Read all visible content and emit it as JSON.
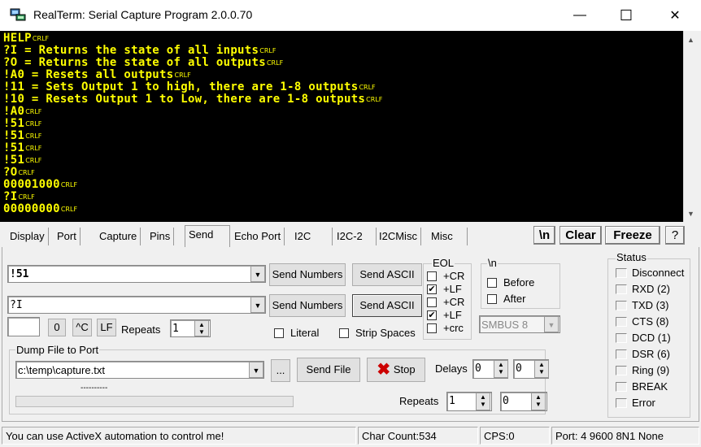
{
  "window": {
    "title": "RealTerm: Serial Capture Program 2.0.0.70",
    "minimize": "—",
    "maximize": "☐",
    "close": "✕"
  },
  "terminal": {
    "eol_marker": "CRLF",
    "lines": [
      "HELP",
      "?I = Returns the state of all inputs",
      "?O = Returns the state of all outputs",
      "!A0 = Resets all outputs",
      "!11 = Sets Output 1 to high, there are 1-8 outputs",
      "!10 = Resets Output 1 to Low, there are 1-8 outputs",
      "!A0",
      "!51",
      "!51",
      "!51",
      "!51",
      "?O",
      "00001000",
      "?I",
      "00000000"
    ]
  },
  "tabs": [
    "Display",
    "Port",
    "Capture",
    "Pins",
    "Send",
    "Echo Port",
    "I2C",
    "I2C-2",
    "I2CMisc",
    "Misc"
  ],
  "active_tab": "Send",
  "toolbar": {
    "newline": "\\n",
    "clear": "Clear",
    "freeze": "Freeze",
    "help": "?"
  },
  "send": {
    "line1_value": "!51",
    "line2_value": "?I",
    "send_numbers": "Send Numbers",
    "send_ascii": "Send ASCII",
    "char_value": "",
    "zero_button": "0",
    "ctrl_c_button": "^C",
    "lf_button": "LF",
    "repeats_label": "Repeats",
    "repeats_value": "1",
    "literal": "Literal",
    "strip_spaces": "Strip Spaces"
  },
  "eol": {
    "title": "EOL",
    "items": [
      {
        "label": "+CR",
        "checked": false
      },
      {
        "label": "+LF",
        "checked": true
      },
      {
        "label": "+CR",
        "checked": false
      },
      {
        "label": "+LF",
        "checked": true
      },
      {
        "label": "+crc",
        "checked": false
      }
    ]
  },
  "newline_group": {
    "title": "\\n",
    "before": "Before",
    "after": "After"
  },
  "smbus": "SMBUS 8",
  "dump": {
    "title": "Dump File to Port",
    "path": "c:\\temp\\capture.txt",
    "browse": "...",
    "send_file": "Send File",
    "stop": "Stop",
    "delays_label": "Delays",
    "delay1": "0",
    "delay2": "0",
    "repeats_label": "Repeats",
    "repeats1": "1",
    "repeats2": "0",
    "progress_text": "----------"
  },
  "status": {
    "title": "Status",
    "items": [
      "Disconnect",
      "RXD (2)",
      "TXD (3)",
      "CTS (8)",
      "DCD (1)",
      "DSR (6)",
      "Ring (9)",
      "BREAK",
      "Error"
    ]
  },
  "statusbar": {
    "message": "You can use ActiveX automation to control me!",
    "char_count": "Char Count:534",
    "cps": "CPS:0",
    "port": "Port: 4 9600 8N1 None"
  },
  "colors": {
    "terminal_bg": "#000000",
    "terminal_fg": "#ffff00",
    "stop_icon": "#cc0000"
  }
}
